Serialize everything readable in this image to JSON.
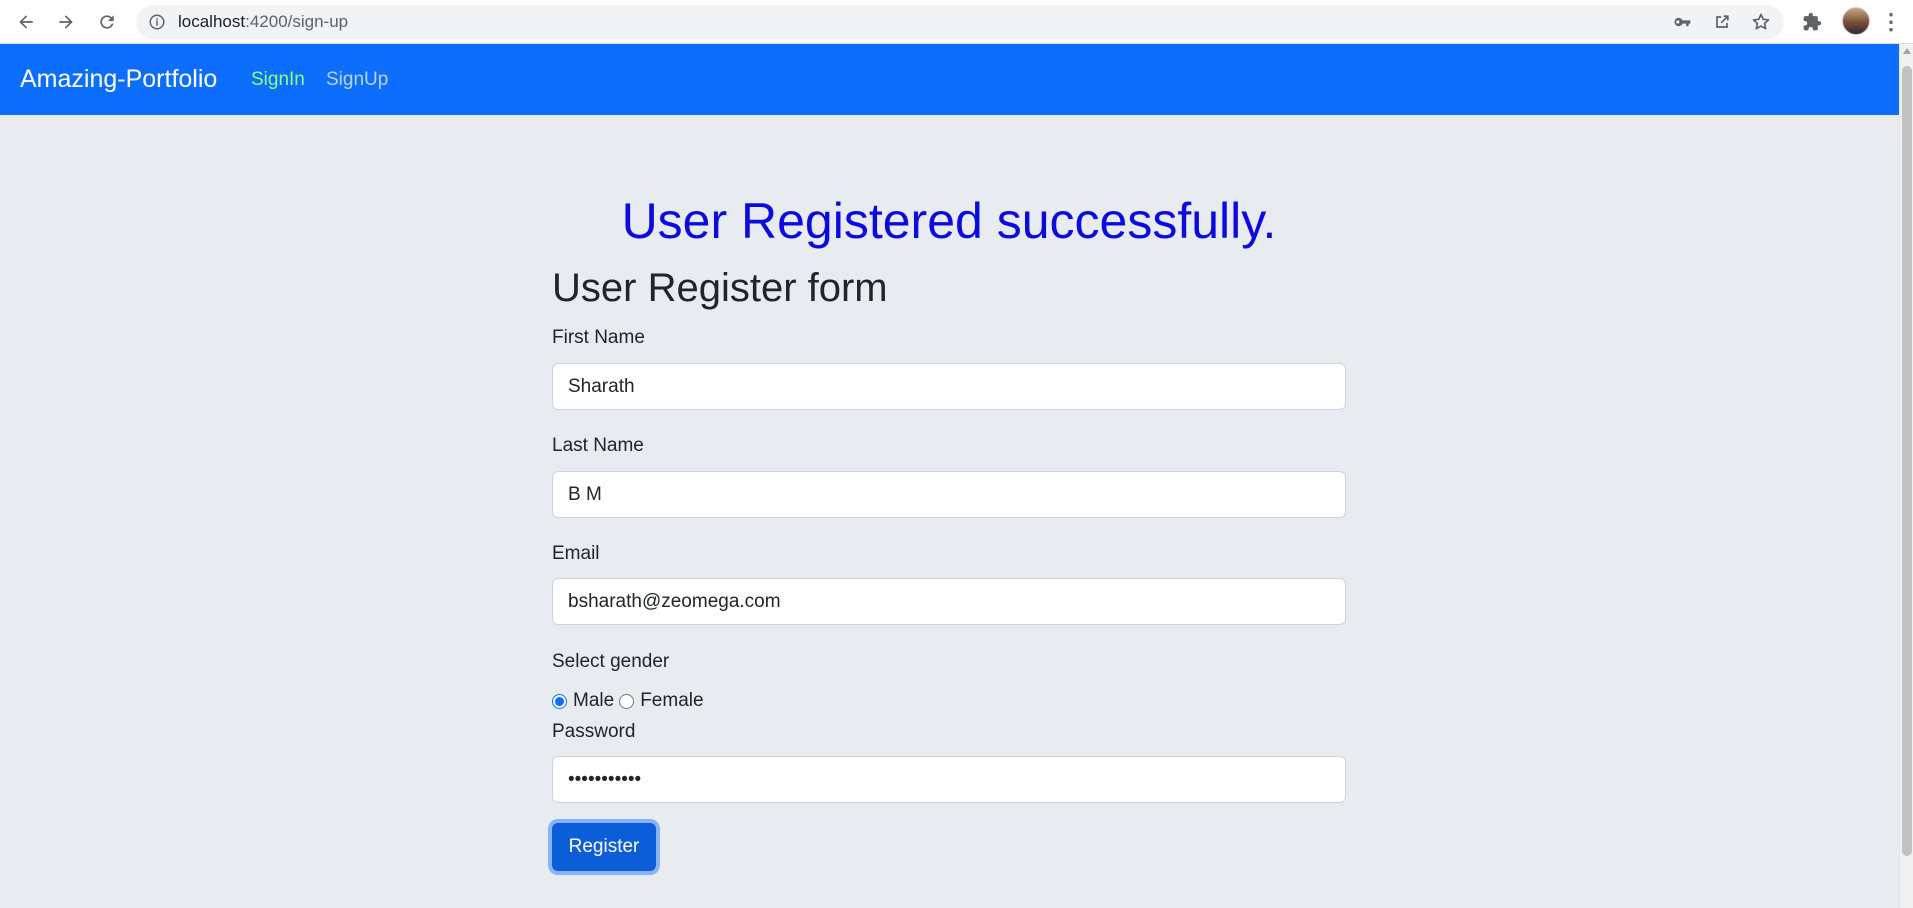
{
  "browser": {
    "url_host": "localhost",
    "url_path": ":4200/sign-up"
  },
  "navbar": {
    "brand": "Amazing-Portfolio",
    "links": [
      {
        "label": "SignIn"
      },
      {
        "label": "SignUp"
      }
    ]
  },
  "main": {
    "success_message": "User Registered successfully.",
    "form_title": "User Register form",
    "first_name": {
      "label": "First Name",
      "value": "Sharath"
    },
    "last_name": {
      "label": "Last Name",
      "value": "B M"
    },
    "email": {
      "label": "Email",
      "value": "bsharath@zeomega.com"
    },
    "gender": {
      "label": "Select gender",
      "options": [
        {
          "label": "Male",
          "checked": true
        },
        {
          "label": "Female",
          "checked": false
        }
      ]
    },
    "password": {
      "label": "Password",
      "value": "sharath1234"
    },
    "register_label": "Register"
  },
  "colors": {
    "navbar": "#0d6efd",
    "active_link": "#8fff7a",
    "success_text": "#0b0be0",
    "page_background": "#e8ebef"
  },
  "icons": [
    "back-arrow-icon",
    "forward-arrow-icon",
    "reload-icon",
    "info-icon",
    "key-icon",
    "share-icon",
    "star-icon",
    "puzzle-extension-icon",
    "more-vert-icon"
  ]
}
